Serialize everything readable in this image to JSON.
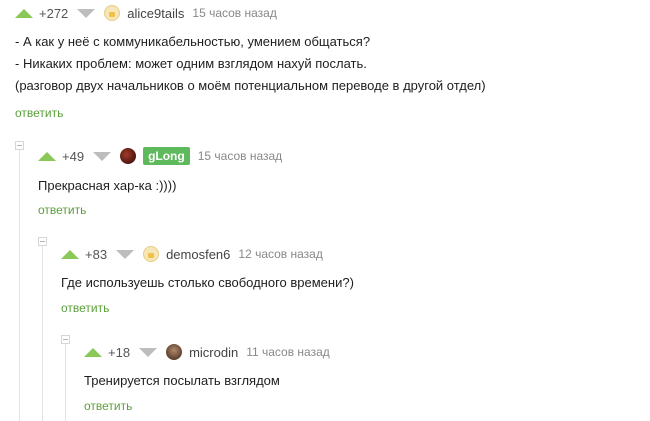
{
  "comments": [
    {
      "rating": "+272",
      "username": "alice9tails",
      "time": "15 часов назад",
      "lines": [
        "- А как у неё с коммуникабельностью, умением общаться?",
        "- Никаких проблем: может одним взглядом нахуй послать.",
        "(разговор двух начальников о моём потенциальном переводе в другой отдел)"
      ],
      "reply": "ответить"
    },
    {
      "rating": "+49",
      "username": "gLong",
      "time": "15 часов назад",
      "lines": [
        "Прекрасная хар-ка :))))"
      ],
      "reply": "ответить"
    },
    {
      "rating": "+83",
      "username": "demosfen6",
      "time": "12 часов назад",
      "lines": [
        "Где используешь столько свободного времени?)"
      ],
      "reply": "ответить"
    },
    {
      "rating": "+18",
      "username": "microdin",
      "time": "11 часов назад",
      "lines": [
        "Тренируется посылать взглядом"
      ],
      "reply": "ответить"
    }
  ],
  "colors": {
    "accent": "#8ac858",
    "reply": "#5a9f3a",
    "badge": "#5eb85c",
    "downvote": "#bdbdbd"
  },
  "icons": [
    "upvote-icon",
    "downvote-icon",
    "avatar",
    "collapse-toggle-icon"
  ]
}
